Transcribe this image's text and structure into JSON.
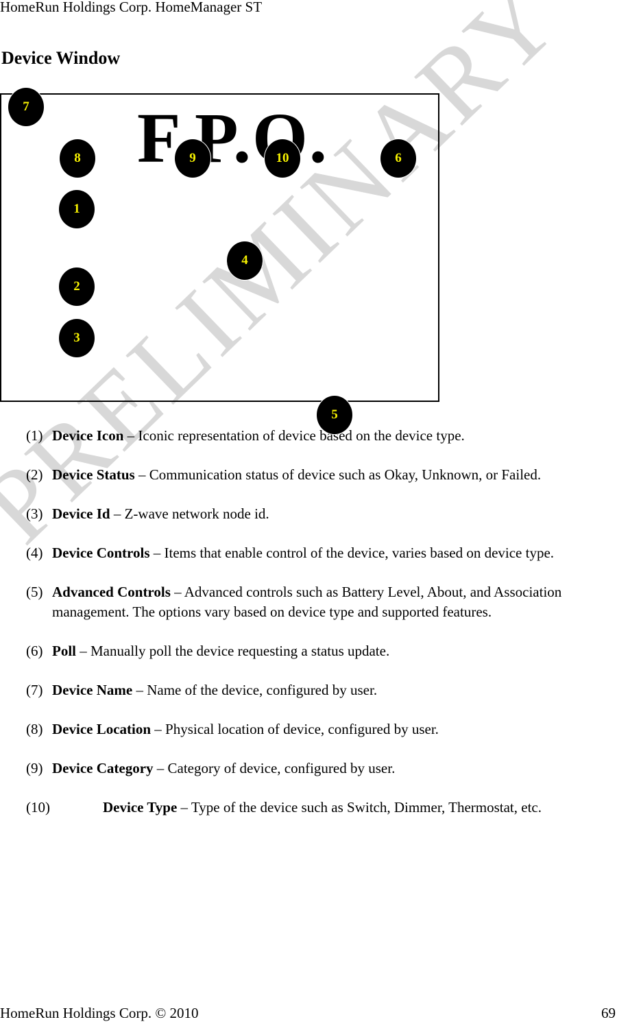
{
  "header": {
    "text": "HomeRun Holdings Corp. HomeManager ST"
  },
  "title": "Device Window",
  "watermark": "PRELIMINARY",
  "figure": {
    "placeholder": "F.P.O.",
    "callouts": [
      "1",
      "2",
      "3",
      "4",
      "5",
      "6",
      "7",
      "8",
      "9",
      "10"
    ]
  },
  "items": [
    {
      "num": "(1)",
      "term": "Device Icon",
      "desc": " – Iconic representation of device based on the device type."
    },
    {
      "num": "(2)",
      "term": "Device Status",
      "desc": " – Communication status of device such as Okay, Unknown, or Failed."
    },
    {
      "num": "(3)",
      "term": "Device Id",
      "desc": " – Z-wave network node id."
    },
    {
      "num": "(4)",
      "term": "Device Controls",
      "desc": " – Items that enable control of the device, varies based on device type."
    },
    {
      "num": "(5)",
      "term": "Advanced Controls",
      "desc": " – Advanced controls such as Battery Level, About, and Association management. The options vary based on device type and supported features."
    },
    {
      "num": "(6)",
      "term": "Poll",
      "desc": " – Manually poll the device requesting a status update."
    },
    {
      "num": "(7)",
      "term": "Device Name",
      "desc": " – Name of the device, configured by user."
    },
    {
      "num": "(8)",
      "term": "Device Location",
      "desc": " – Physical location of device, configured by user."
    },
    {
      "num": "(9)",
      "term": "Device Category",
      "desc": " – Category of device, configured by user."
    },
    {
      "num": "(10)",
      "term": "Device Type",
      "desc": " – Type of the device such as Switch, Dimmer, Thermostat, etc."
    }
  ],
  "footer": {
    "left": "HomeRun Holdings Corp. © 2010",
    "page": "69"
  }
}
